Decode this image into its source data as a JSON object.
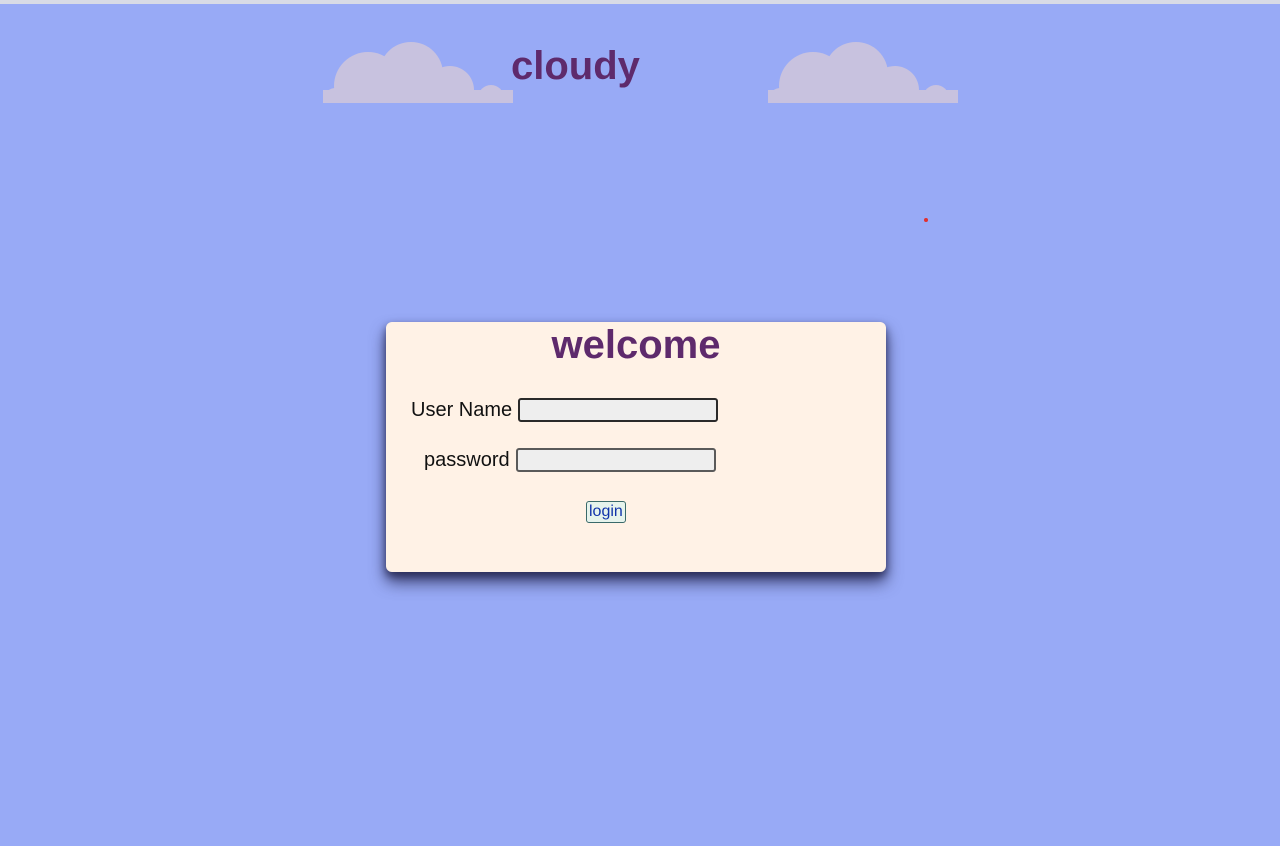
{
  "header": {
    "title": "cloudy",
    "decorations": [
      "cloud-icon",
      "cloud-icon"
    ]
  },
  "login_form": {
    "heading": "welcome",
    "username_label": "User Name",
    "username_value": "",
    "password_label": "password",
    "password_value": "",
    "submit_label": "login"
  },
  "colors": {
    "background": "#98aaf6",
    "card": "#fff2e6",
    "title": "#5e2a6c",
    "cloud": "#c8c2df"
  }
}
